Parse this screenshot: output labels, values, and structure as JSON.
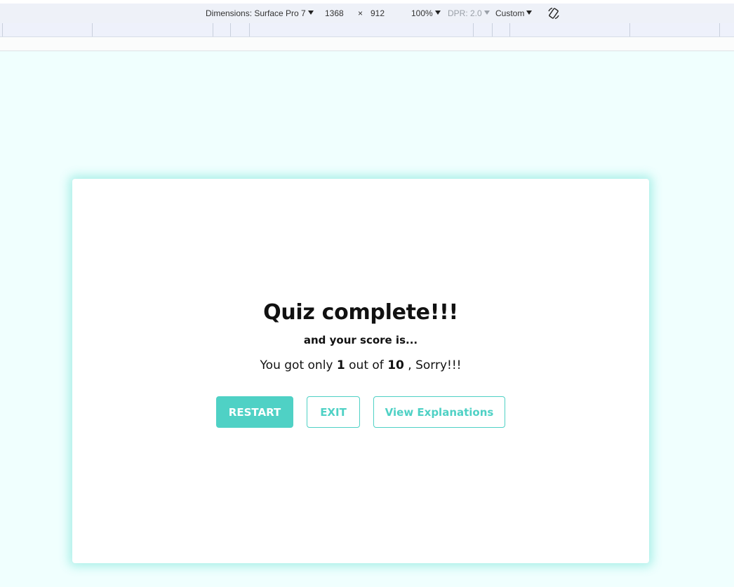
{
  "devtools": {
    "dimensions_label": "Dimensions: Surface Pro 7",
    "width": "1368",
    "times": "×",
    "height": "912",
    "zoom": "100%",
    "dpr": "DPR: 2.0",
    "throttle": "Custom"
  },
  "quiz": {
    "title": "Quiz complete!!!",
    "subtitle": "and your score is...",
    "score_prefix": "You got only",
    "score_value": "1",
    "score_middle": "out of",
    "score_total": "10",
    "score_suffix": ", Sorry!!!"
  },
  "buttons": {
    "restart": "RESTART",
    "exit": "EXIT",
    "explanations": "View Explanations"
  },
  "colors": {
    "accent": "#4fd1c5",
    "page_background": "#f0fffe",
    "card_background": "#ffffff"
  }
}
